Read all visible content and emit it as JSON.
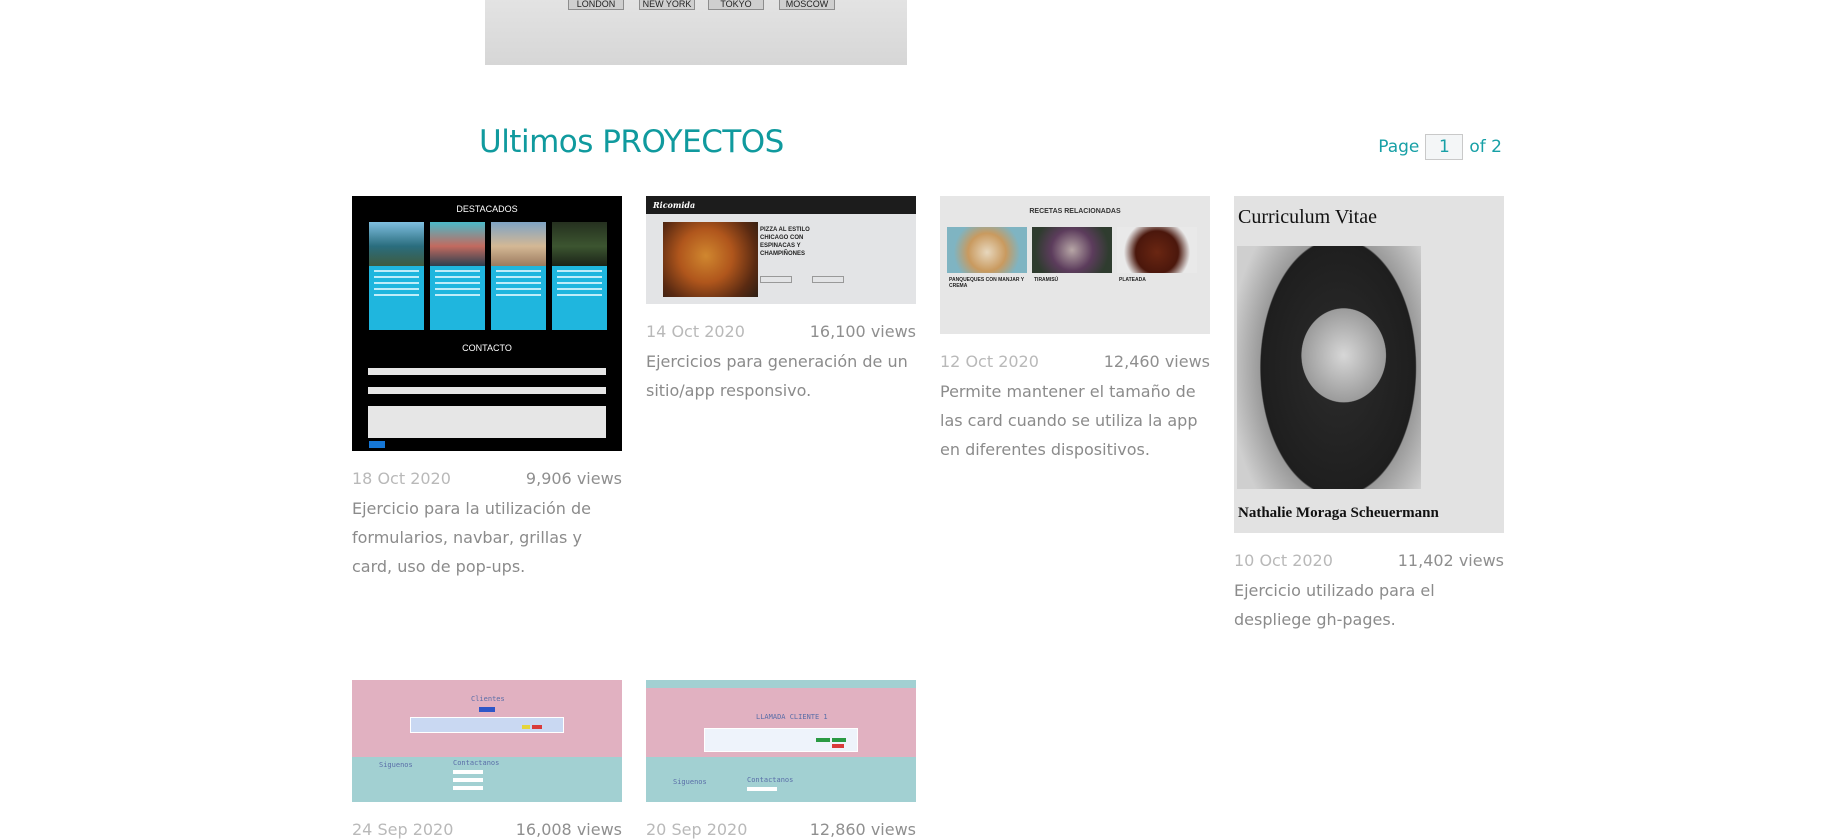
{
  "top_banner": {
    "cities": [
      "LONDON",
      "NEW YORK",
      "TOKYO",
      "MOSCOW"
    ]
  },
  "section": {
    "title": "Ultimos PROYECTOS"
  },
  "pager": {
    "prefix": "Page",
    "current": "1",
    "suffix": "of 2"
  },
  "projects": [
    {
      "date": "18 Oct 2020",
      "views": "9,906 views",
      "description": "Ejercicio para la utilización de formularios, navbar, grillas y card, uso de pop-ups.",
      "thumb": {
        "heading": "DESTACADOS",
        "card_title": "Lorem Ipsum",
        "contact": "CONTACTO"
      }
    },
    {
      "date": "14 Oct 2020",
      "views": "16,100 views",
      "description": "Ejercicios para generación de un sitio/app responsivo.",
      "thumb": {
        "brand": "Ricomida",
        "recipe": "PIZZA AL ESTILO CHICAGO CON ESPINACAS Y CHAMPIÑONES"
      }
    },
    {
      "date": "12 Oct 2020",
      "views": "12,460 views",
      "description": "Permite mantener el tamaño de las card cuando se utiliza la app en diferentes dispositivos.",
      "thumb": {
        "heading": "RECETAS RELACIONADAS",
        "items": [
          "PANQUEQUES CON MANJAR Y CREMA",
          "TIRAMISÚ",
          "PLATEADA"
        ]
      }
    },
    {
      "date": "10 Oct 2020",
      "views": "11,402 views",
      "description": "Ejercicio utilizado para el despliege gh-pages.",
      "thumb": {
        "title": "Curriculum Vitae",
        "name": "Nathalie Moraga Scheuermann"
      }
    },
    {
      "date": "24 Sep 2020",
      "views": "16,008 views",
      "description": "",
      "thumb": {
        "title": "Clientes",
        "footer_left": "Siguenos",
        "footer_mid": "Contactanos"
      }
    },
    {
      "date": "20 Sep 2020",
      "views": "12,860 views",
      "description": "",
      "thumb": {
        "title": "LLAMADA CLIENTE 1",
        "footer_left": "Siguenos",
        "footer_mid": "Contactanos"
      }
    }
  ],
  "colors": {
    "accent": "#109a9e",
    "date": "#b9b9b9",
    "text": "#8b8b8b"
  }
}
